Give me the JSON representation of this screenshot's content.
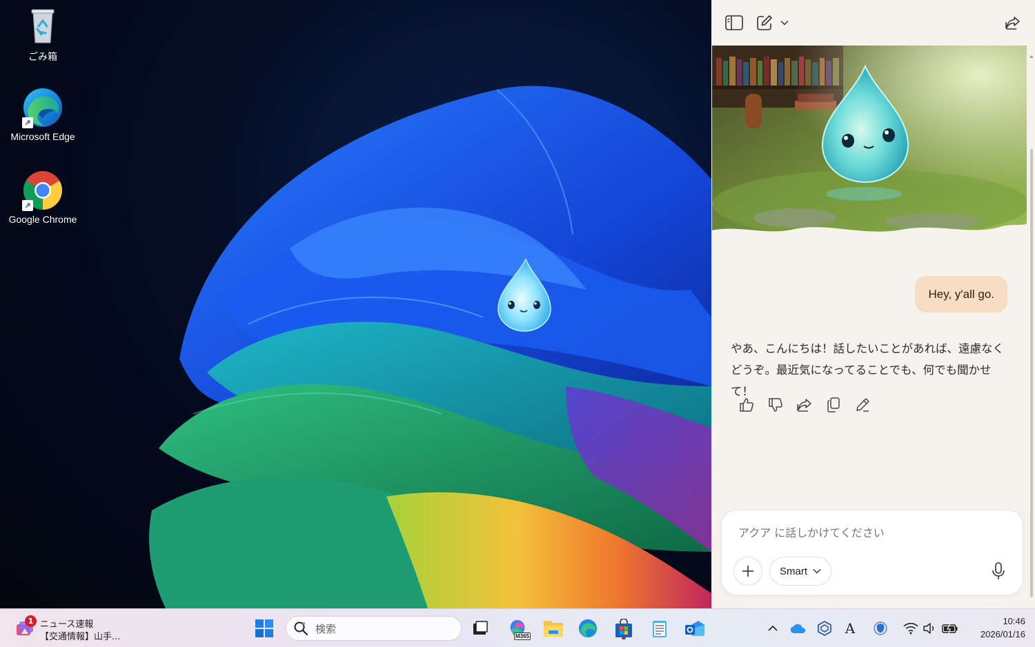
{
  "desktop": {
    "icons": [
      {
        "label": "ごみ箱",
        "icon": "recycle-bin-icon"
      },
      {
        "label": "Microsoft Edge",
        "icon": "edge-icon"
      },
      {
        "label": "Google Chrome",
        "icon": "chrome-icon"
      }
    ]
  },
  "copilot": {
    "header_icons": [
      "sidebar-toggle-icon",
      "new-chat-icon",
      "chevron-down-icon",
      "share-icon"
    ],
    "user_message": "Hey, y'all go.",
    "assistant_message": "やあ、こんにちは！話したいことがあれば、遠慮なくどうぞ。最近気になってることでも、何でも聞かせて！",
    "action_icons": [
      "thumbs-up-icon",
      "thumbs-down-icon",
      "share-icon",
      "copy-icon",
      "edit-icon"
    ],
    "composer": {
      "placeholder": "アクア に話しかけてください",
      "value": "",
      "mode_label": "Smart"
    },
    "accent": "#f5dcc3"
  },
  "taskbar": {
    "news": {
      "badge": "1",
      "line1": "ニュース速報",
      "line2": "【交通情報】山手..."
    },
    "search_placeholder": "検索",
    "apps": [
      "start-icon",
      "task-view-icon",
      "m365-icon",
      "file-explorer-icon",
      "edge-icon",
      "store-icon",
      "notepad-icon",
      "outlook-icon"
    ],
    "m365_label": "M365",
    "tray_icons": [
      "chevron-up-icon",
      "onedrive-icon",
      "copilot-tray-icon",
      "ime-icon",
      "defender-icon",
      "wifi-icon",
      "volume-icon",
      "battery-icon"
    ],
    "ime_label": "A",
    "clock": {
      "time": "10:46",
      "date": "2026/01/16"
    }
  }
}
